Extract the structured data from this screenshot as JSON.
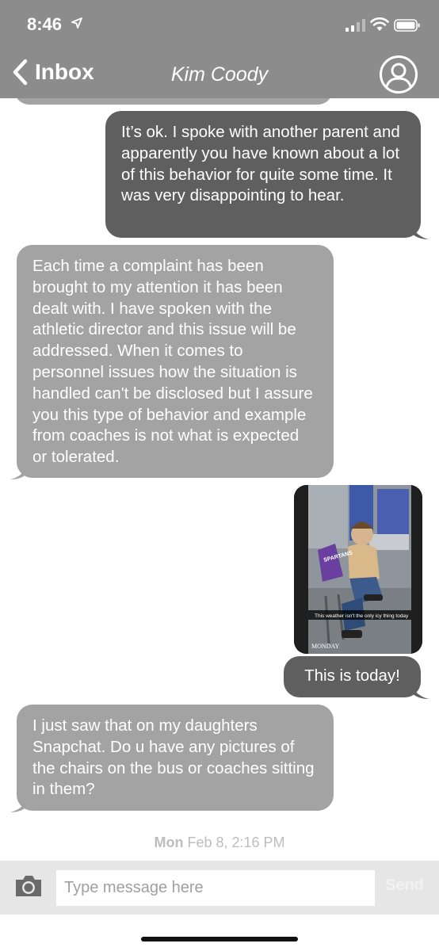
{
  "status_bar": {
    "time": "8:46"
  },
  "nav": {
    "back_label": "Inbox",
    "title": "Kim Coody"
  },
  "messages": [
    {
      "direction": "outgoing",
      "text": "It’s ok. I spoke with another parent and apparently you have known about a lot of this behavior for quite some time. It was very disappointing to hear."
    },
    {
      "direction": "incoming",
      "text": "Each time a complaint has been brought to my attention it has been dealt with. I have spoken with the athletic director and this issue will be addressed. When it comes to personnel issues how the situation is handled can't be disclosed but I assure you this type of behavior and example from coaches is not what is expected or tolerated."
    },
    {
      "direction": "outgoing",
      "type": "photo",
      "caption": "This weather isn't the only icy thing today",
      "chair_text": "SPARTANS",
      "date_text": "MONDAY"
    },
    {
      "direction": "outgoing",
      "text": "This is today!"
    },
    {
      "direction": "incoming",
      "text": "I just saw that on my daughters Snapchat. Do u have any pictures of the chairs on the bus or coaches sitting in them?"
    }
  ],
  "timestamp": {
    "day": "Mon",
    "rest": "Feb 8, 2:16 PM"
  },
  "composer": {
    "placeholder": "Type message here",
    "send_label": "Send"
  },
  "colors": {
    "header": "#8c8c8c",
    "incoming_bubble": "#a3a3a3",
    "outgoing_bubble": "#5f5f5f",
    "composer_bg": "#e6e6e6"
  },
  "icons": [
    "location-arrow-icon",
    "signal-icon",
    "wifi-icon",
    "battery-icon",
    "chevron-left-icon",
    "user-avatar-icon",
    "camera-icon"
  ]
}
